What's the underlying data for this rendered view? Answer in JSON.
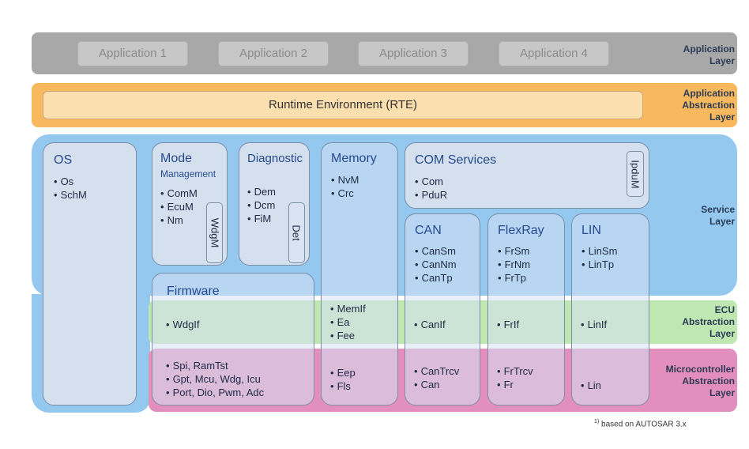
{
  "layers": {
    "application": "Application Layer",
    "rte": "Application Abstraction Layer",
    "service": "Service Layer",
    "ecu": "ECU Abstraction Layer",
    "mcu": "Microcontroller Abstraction Layer"
  },
  "applications": [
    "Application 1",
    "Application 2",
    "Application 3",
    "Application 4"
  ],
  "rte": "Runtime Environment (RTE)",
  "os": {
    "title": "OS",
    "items": [
      "Os",
      "SchM"
    ]
  },
  "mode": {
    "title": "Mode",
    "subtitle": "Management",
    "items": [
      "ComM",
      "EcuM",
      "Nm"
    ],
    "side": "WdgM"
  },
  "diagnostic": {
    "title": "Diagnostic",
    "items": [
      "Dem",
      "Dcm",
      "FiM"
    ],
    "side": "Det"
  },
  "memory": {
    "title": "Memory",
    "items": [
      "NvM",
      "Crc"
    ],
    "ecu_items": [
      "MemIf",
      "Ea",
      "Fee"
    ],
    "mcu_items": [
      "Eep",
      "Fls"
    ]
  },
  "com_services": {
    "title": "COM Services",
    "items": [
      "Com",
      "PduR"
    ],
    "side": "IpduM"
  },
  "can": {
    "title": "CAN",
    "items": [
      "CanSm",
      "CanNm",
      "CanTp"
    ],
    "ecu_items": [
      "CanIf"
    ],
    "mcu_items": [
      "CanTrcv",
      "Can"
    ]
  },
  "flexray": {
    "title": "FlexRay",
    "items": [
      "FrSm",
      "FrNm",
      "FrTp"
    ],
    "ecu_items": [
      "FrIf"
    ],
    "mcu_items": [
      "FrTrcv",
      "Fr"
    ]
  },
  "lin": {
    "title": "LIN",
    "items": [
      "LinSm",
      "LinTp"
    ],
    "ecu_items": [
      "LinIf"
    ],
    "mcu_items": [
      "Lin"
    ]
  },
  "firmware": {
    "title": "Firmware",
    "ecu_items": [
      "WdgIf"
    ],
    "mcu_items": [
      "Spi, RamTst",
      "Gpt, Mcu, Wdg, Icu",
      "Port, Dio, Pwm, Adc"
    ]
  },
  "footnote": {
    "mark": "1)",
    "text": "based on AUTOSAR 3.x"
  },
  "colors": {
    "application_band": "#a8a8a8",
    "rte_band": "#f7b85e",
    "service_band": "#94c8ef",
    "ecu_band": "#bfe7b2",
    "mcu_band": "#e38fbd",
    "title_text": "#264a8f"
  }
}
